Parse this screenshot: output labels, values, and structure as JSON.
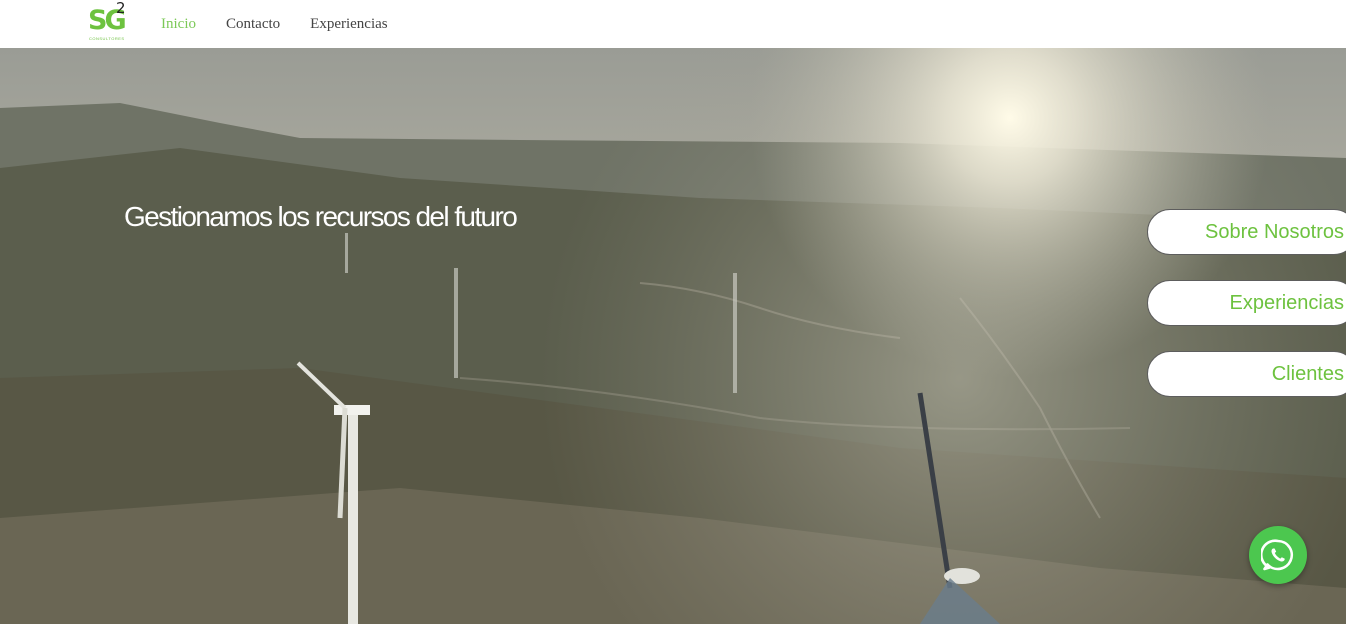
{
  "header": {
    "logo": {
      "text": "SG",
      "superscript": "2",
      "subtitle": "CONSULTORES",
      "brand_color": "#6dc23f"
    },
    "nav": [
      {
        "label": "Inicio",
        "active": true
      },
      {
        "label": "Contacto",
        "active": false
      },
      {
        "label": "Experiencias",
        "active": false
      }
    ],
    "active_color": "#7cc958"
  },
  "hero": {
    "background": "aerial video of wind turbines on misty hills",
    "headline": "Gestionamos los recursos del futuro",
    "buttons": [
      {
        "label": "Sobre Nosotros"
      },
      {
        "label": "Experiencias"
      },
      {
        "label": "Clientes"
      }
    ]
  },
  "whatsapp": {
    "icon": "whatsapp-icon",
    "color": "#4cc74f"
  }
}
